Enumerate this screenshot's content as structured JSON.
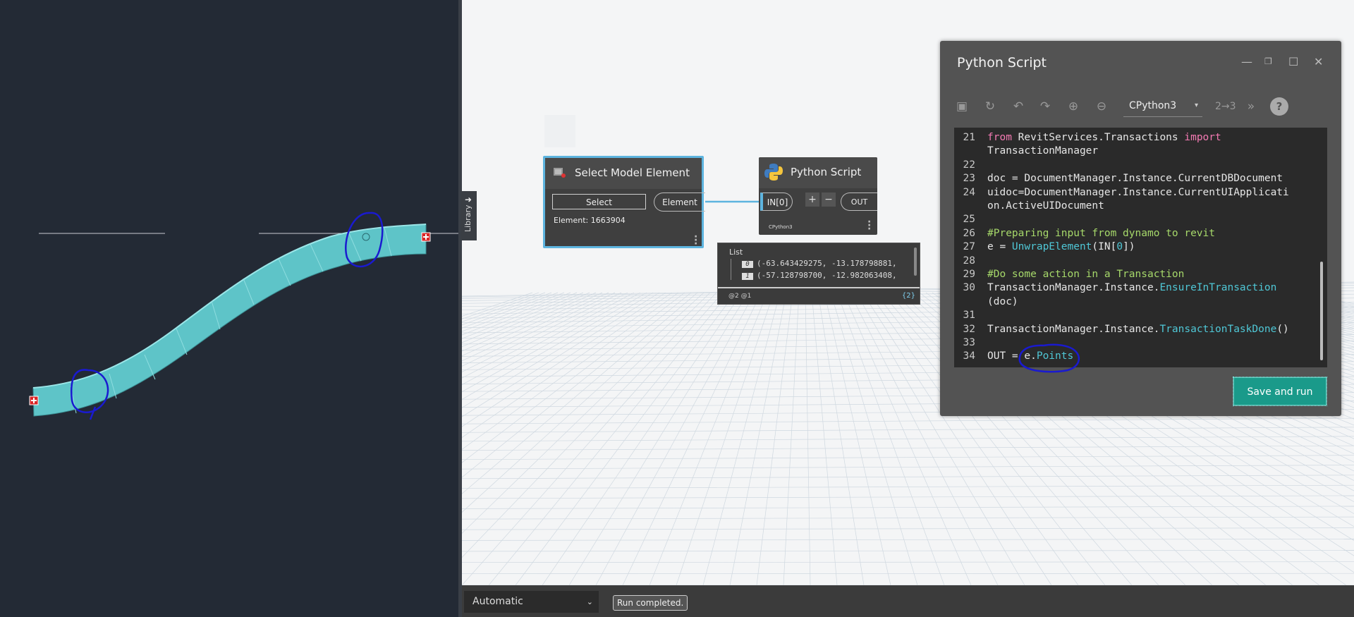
{
  "revit_view": {
    "name": "revit-3d-view"
  },
  "library": {
    "label": "Library",
    "icon": "arrow-right-icon"
  },
  "nodes": {
    "select_model_element": {
      "title": "Select Model Element",
      "button_label": "Select",
      "output_port": "Element",
      "element_text": "Element: 1663904"
    },
    "python_script": {
      "title": "Python Script",
      "input_port": "IN[0]",
      "add_label": "+",
      "remove_label": "−",
      "output_port": "OUT",
      "engine": "CPython3"
    }
  },
  "preview": {
    "label": "List",
    "rows": [
      {
        "index": "0",
        "value": "(-63.643429275, -13.178798881,"
      },
      {
        "index": "1",
        "value": "(-57.128798700, -12.982063408,"
      }
    ],
    "levels": "@2 @1",
    "count": "{2}"
  },
  "editor": {
    "title": "Python Script",
    "engine": "CPython3",
    "save_run_label": "Save and run",
    "lines": [
      {
        "n": "21",
        "parts": [
          [
            "kw",
            "from "
          ],
          [
            "",
            "RevitServices.Transactions "
          ],
          [
            "kw",
            "import"
          ]
        ]
      },
      {
        "n": "",
        "parts": [
          [
            "",
            "TransactionManager"
          ]
        ]
      },
      {
        "n": "22",
        "parts": []
      },
      {
        "n": "23",
        "parts": [
          [
            "",
            "doc = DocumentManager.Instance.CurrentDBDocument"
          ]
        ]
      },
      {
        "n": "24",
        "parts": [
          [
            "",
            "uidoc=DocumentManager.Instance.CurrentUIApplicati"
          ]
        ]
      },
      {
        "n": "",
        "parts": [
          [
            "",
            "on.ActiveUIDocument"
          ]
        ]
      },
      {
        "n": "25",
        "parts": []
      },
      {
        "n": "26",
        "parts": [
          [
            "cm",
            "#Preparing input from dynamo to revit"
          ]
        ]
      },
      {
        "n": "27",
        "parts": [
          [
            "",
            "e = "
          ],
          [
            "fn",
            "UnwrapElement"
          ],
          [
            "",
            "(IN["
          ],
          [
            "nm",
            "0"
          ],
          [
            "",
            "])"
          ]
        ]
      },
      {
        "n": "28",
        "parts": []
      },
      {
        "n": "29",
        "parts": [
          [
            "cm",
            "#Do some action in a Transaction"
          ]
        ]
      },
      {
        "n": "30",
        "parts": [
          [
            "",
            "TransactionManager.Instance."
          ],
          [
            "fn",
            "EnsureInTransaction"
          ]
        ]
      },
      {
        "n": "",
        "parts": [
          [
            "",
            "(doc)"
          ]
        ]
      },
      {
        "n": "31",
        "parts": []
      },
      {
        "n": "32",
        "parts": [
          [
            "",
            "TransactionManager.Instance."
          ],
          [
            "fn",
            "TransactionTaskDone"
          ],
          [
            "",
            "()"
          ]
        ]
      },
      {
        "n": "33",
        "parts": []
      },
      {
        "n": "34",
        "parts": [
          [
            "",
            "OUT = e."
          ],
          [
            "fn",
            "Points"
          ]
        ]
      }
    ]
  },
  "statusbar": {
    "run_mode": "Automatic",
    "run_status": "Run completed."
  },
  "colors": {
    "accent": "#5db4df",
    "save_button": "#1a9a8a",
    "pipe": "#5ec4c8",
    "annotation": "#1a1ad0"
  }
}
